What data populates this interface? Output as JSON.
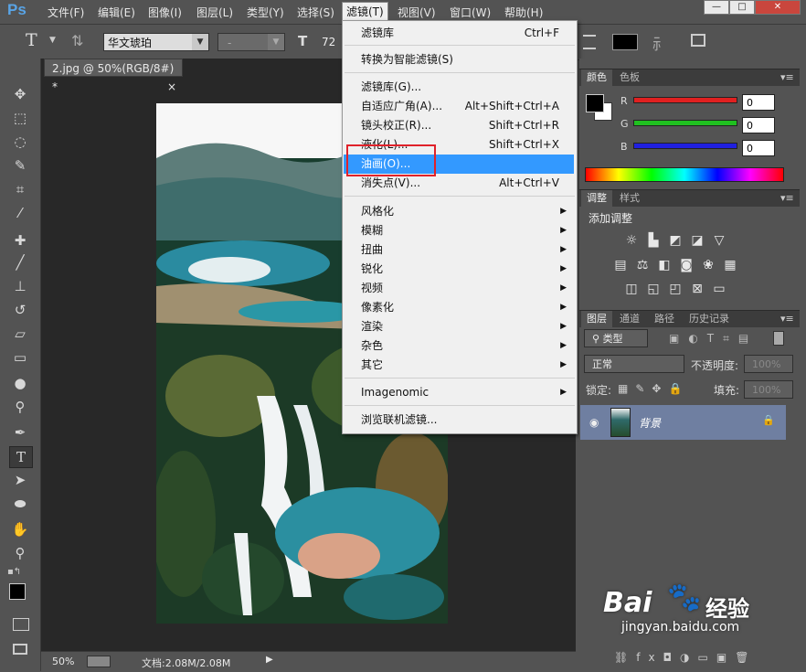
{
  "app": {
    "logo": "Ps"
  },
  "menubar": {
    "items": [
      "文件(F)",
      "编辑(E)",
      "图像(I)",
      "图层(L)",
      "类型(Y)",
      "选择(S)",
      "滤镜(T)",
      "视图(V)",
      "窗口(W)",
      "帮助(H)"
    ],
    "active": "滤镜(T)"
  },
  "window_controls": {
    "minimize": "—",
    "maximize": "□",
    "close": "✕"
  },
  "options_bar": {
    "tool_glyph": "T",
    "font_family": "华文琥珀",
    "font_style": "-",
    "font_size": "72"
  },
  "document": {
    "tab_title": "2.jpg @ 50%(RGB/8#) *",
    "tab_close": "×"
  },
  "statusbar": {
    "zoom": "50%",
    "doc_info": "文档:2.08M/2.08M"
  },
  "filter_menu": {
    "items": [
      {
        "label": "滤镜库",
        "shortcut": "Ctrl+F"
      },
      {
        "sep": true
      },
      {
        "label": "转换为智能滤镜(S)"
      },
      {
        "sep": true
      },
      {
        "label": "滤镜库(G)..."
      },
      {
        "label": "自适应广角(A)...",
        "shortcut": "Alt+Shift+Ctrl+A"
      },
      {
        "label": "镜头校正(R)...",
        "shortcut": "Shift+Ctrl+R"
      },
      {
        "label": "液化(L)...",
        "shortcut": "Shift+Ctrl+X"
      },
      {
        "label": "油画(O)...",
        "highlighted": true
      },
      {
        "label": "消失点(V)...",
        "shortcut": "Alt+Ctrl+V"
      },
      {
        "sep": true
      },
      {
        "label": "风格化",
        "submenu": true
      },
      {
        "label": "模糊",
        "submenu": true
      },
      {
        "label": "扭曲",
        "submenu": true
      },
      {
        "label": "锐化",
        "submenu": true
      },
      {
        "label": "视频",
        "submenu": true
      },
      {
        "label": "像素化",
        "submenu": true
      },
      {
        "label": "渲染",
        "submenu": true
      },
      {
        "label": "杂色",
        "submenu": true
      },
      {
        "label": "其它",
        "submenu": true
      },
      {
        "sep": true
      },
      {
        "label": "Imagenomic",
        "submenu": true
      },
      {
        "sep": true
      },
      {
        "label": "浏览联机滤镜..."
      }
    ]
  },
  "color_panel": {
    "tabs": [
      "颜色",
      "色板"
    ],
    "channels": [
      {
        "label": "R",
        "value": "0",
        "color": "#e02020"
      },
      {
        "label": "G",
        "value": "0",
        "color": "#20c020"
      },
      {
        "label": "B",
        "value": "0",
        "color": "#2020e0"
      }
    ],
    "foreground": "#000000",
    "background": "#ffffff"
  },
  "adjustments_panel": {
    "tabs": [
      "调整",
      "样式"
    ],
    "title": "添加调整"
  },
  "layers_panel": {
    "tabs": [
      "图层",
      "通道",
      "路径",
      "历史记录"
    ],
    "filter_kind": "类型",
    "blend_mode": "正常",
    "opacity_label": "不透明度:",
    "opacity_value": "100%",
    "lock_label": "锁定:",
    "fill_label": "填充:",
    "fill_value": "100%",
    "layers": [
      {
        "name": "背景",
        "visible": true,
        "locked": true
      }
    ]
  },
  "watermark": {
    "brand": "Bai",
    "brand_cn": "经验",
    "url": "jingyan.baidu.com"
  },
  "colors": {
    "accent": "#3399ff",
    "highlight_box": "#e0222a",
    "layer_selected": "#6f7fa1"
  }
}
